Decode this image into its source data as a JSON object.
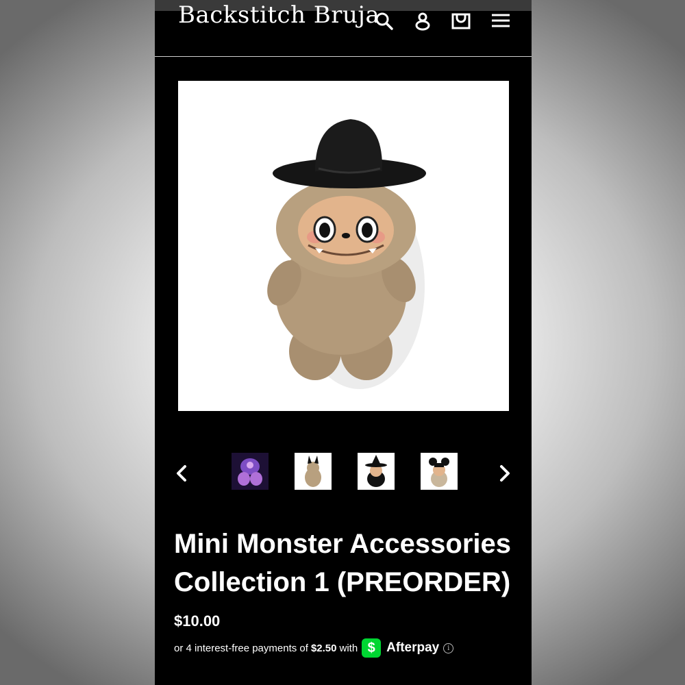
{
  "header": {
    "logo_text": "Backstitch Bruja",
    "icons": [
      "search-icon",
      "account-icon",
      "cart-icon",
      "menu-icon"
    ]
  },
  "product": {
    "title_line1": "Mini Monster Accessories",
    "title_line2": "Collection 1 (PREORDER)",
    "price": "$10.00",
    "installments_prefix": "or 4 interest-free payments of",
    "installment_amount": "$2.50",
    "installments_with": "with",
    "provider": "Afterpay"
  },
  "gallery": {
    "main_image_alt": "plush monster doll wearing a black cowboy hat",
    "thumbnails": [
      "purple-lit dolls",
      "doll with bunny ears",
      "doll in witch hat",
      "doll with mouse ears"
    ]
  },
  "colors": {
    "page_bg": "#000000",
    "text": "#ffffff",
    "cashapp_green": "#00d632"
  }
}
